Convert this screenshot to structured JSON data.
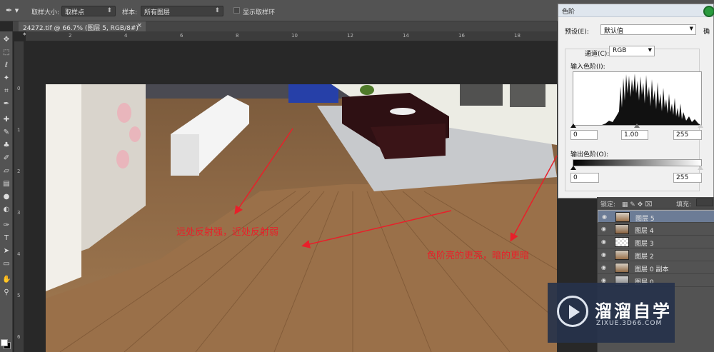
{
  "options_bar": {
    "sample_size_label": "取样大小:",
    "sample_size_value": "取样点",
    "sample_label": "样本:",
    "sample_value": "所有图层",
    "show_ring_label": "显示取样环"
  },
  "document_tab": {
    "title": "24272.tif @ 66.7% (图层 5, RGB/8#) *",
    "close": "×"
  },
  "ruler": {
    "h_numbers": [
      "2",
      "4",
      "6",
      "8",
      "10",
      "12",
      "14",
      "16",
      "18"
    ],
    "v_numbers": [
      "0",
      "1",
      "2",
      "3",
      "4",
      "5",
      "6"
    ]
  },
  "annotations": {
    "left": "远处反射强，近处反射弱",
    "right": "色阶亮的更亮，暗的更暗"
  },
  "levels_dialog": {
    "title": "色阶",
    "preset_label": "预设(E):",
    "preset_value": "默认值",
    "side_button": "确",
    "channel_label": "通道(C):",
    "channel_value": "RGB",
    "input_levels_label": "输入色阶(I):",
    "input_black": "0",
    "input_gamma": "1.00",
    "input_white": "255",
    "output_levels_label": "输出色阶(O):",
    "output_black": "0",
    "output_white": "255"
  },
  "layers_panel": {
    "lock_label": "锁定:",
    "fill_label": "填充:",
    "layers": [
      {
        "name": "图层 5",
        "selected": true
      },
      {
        "name": "图层 4",
        "selected": false
      },
      {
        "name": "图层 3",
        "selected": false
      },
      {
        "name": "图层 2",
        "selected": false
      },
      {
        "name": "图层 0 副本",
        "selected": false
      },
      {
        "name": "图层 0",
        "selected": false
      }
    ]
  },
  "watermark": {
    "brand": "溜溜自学",
    "url": "ZIXUE.3D66.COM"
  },
  "colors": {
    "annotation": "#e8202a",
    "panel": "#535353",
    "selected_layer": "#6c7c96"
  }
}
